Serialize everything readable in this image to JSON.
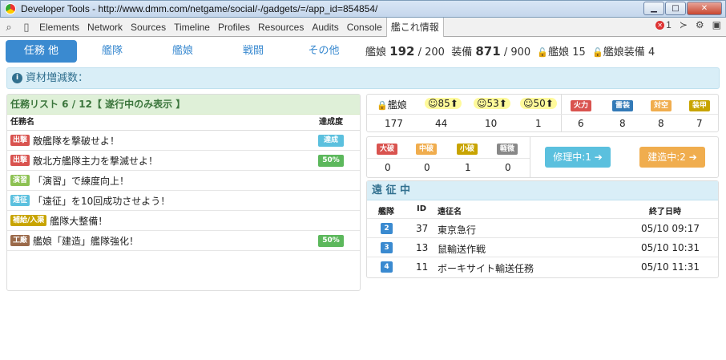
{
  "window": {
    "title": "Developer Tools - http://www.dmm.com/netgame/social/-/gadgets/=/app_id=854854/",
    "min": "▁",
    "max": "□",
    "close": "✕"
  },
  "devtools": {
    "tabs": [
      "Elements",
      "Network",
      "Sources",
      "Timeline",
      "Profiles",
      "Resources",
      "Audits",
      "Console",
      "艦これ情報"
    ],
    "error_count": "1",
    "search_glyph": "⌕",
    "device_glyph": "▯",
    "console_glyph": "≻",
    "gear_glyph": "⚙",
    "dock_glyph": "▣"
  },
  "nav": {
    "tabs": [
      "任務 他",
      "艦隊",
      "艦娘",
      "戦闘",
      "その他"
    ],
    "active_index": 0
  },
  "counts": {
    "ship_label": "艦娘",
    "ship_value": "192",
    "ship_max": "/ 200",
    "equip_label": "装備",
    "equip_value": "871",
    "equip_max": "/ 900",
    "locked_ship_label": "艦娘",
    "locked_ship_value": "15",
    "locked_equip_label": "艦娘装備",
    "locked_equip_value": "4",
    "lock_glyph": "🔓"
  },
  "info": {
    "label": "資材増減数：",
    "glyph": "i"
  },
  "quests": {
    "title": "任務リスト 6 / 12【 遂行中のみ表示 】",
    "col_name": "任務名",
    "col_progress": "達成度",
    "rows": [
      {
        "tag": "出撃",
        "tag_color": "#d9534f",
        "name": "敵艦隊を撃破せよ！",
        "progress": "達成",
        "progress_color": "#5bc0de"
      },
      {
        "tag": "出撃",
        "tag_color": "#d9534f",
        "name": "敵北方艦隊主力を撃滅せよ！",
        "progress": "50%",
        "progress_color": "#5cb85c"
      },
      {
        "tag": "演習",
        "tag_color": "#8cc152",
        "name": "「演習」で練度向上！",
        "progress": "",
        "progress_color": ""
      },
      {
        "tag": "遠征",
        "tag_color": "#5bc0de",
        "name": "「遠征」を10回成功させよう！",
        "progress": "",
        "progress_color": ""
      },
      {
        "tag": "補給/入渠",
        "tag_color": "#c8a400",
        "name": "艦隊大整備！",
        "progress": "",
        "progress_color": ""
      },
      {
        "tag": "工廠",
        "tag_color": "#9b6a4a",
        "name": "艦娘「建造」艦隊強化！",
        "progress": "50%",
        "progress_color": "#5cb85c"
      }
    ]
  },
  "ship_stats": {
    "lock_label": "艦娘",
    "moods": [
      "85",
      "53",
      "50"
    ],
    "mood_glyph": "☺",
    "arrow_glyph": "⬆",
    "values": [
      "177",
      "44",
      "10",
      "1"
    ],
    "stats": [
      {
        "label": "火力",
        "color": "#d9534f",
        "value": "6"
      },
      {
        "label": "雷装",
        "color": "#337ab7",
        "value": "8"
      },
      {
        "label": "対空",
        "color": "#f0ad4e",
        "value": "8"
      },
      {
        "label": "装甲",
        "color": "#c8a400",
        "value": "7"
      }
    ]
  },
  "damage": {
    "labels": [
      {
        "label": "大破",
        "color": "#d9534f",
        "value": "0"
      },
      {
        "label": "中破",
        "color": "#f0ad4e",
        "value": "0"
      },
      {
        "label": "小破",
        "color": "#c8a400",
        "value": "1"
      },
      {
        "label": "軽微",
        "color": "#888888",
        "value": "0"
      }
    ],
    "repair_label": "修理中:1",
    "build_label": "建造中:2",
    "arrow": "➔"
  },
  "expedition": {
    "title": "遠 征 中",
    "col_fleet": "艦隊",
    "col_id": "ID",
    "col_name": "遠征名",
    "col_end": "終了日時",
    "rows": [
      {
        "fleet": "2",
        "id": "37",
        "name": "東京急行",
        "end": "05/10 09:17"
      },
      {
        "fleet": "3",
        "id": "13",
        "name": "鼠輸送作戦",
        "end": "05/10 10:31"
      },
      {
        "fleet": "4",
        "id": "11",
        "name": "ボーキサイト輸送任務",
        "end": "05/10 11:31"
      }
    ]
  }
}
